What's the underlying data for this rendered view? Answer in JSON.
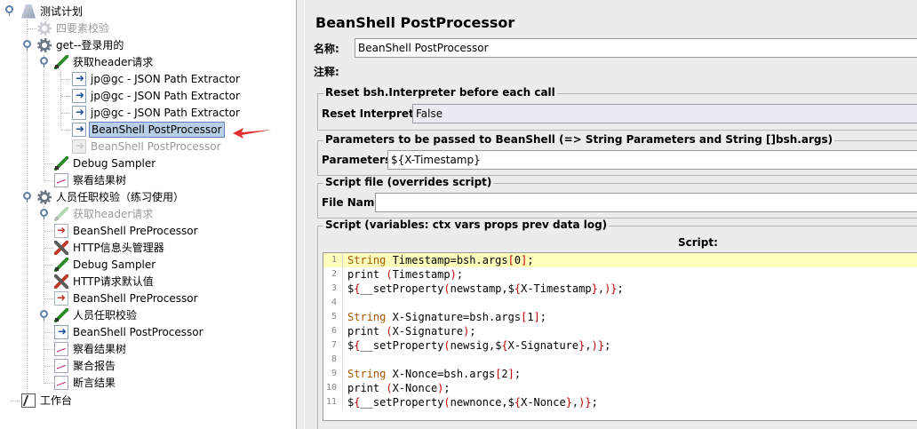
{
  "tree": {
    "root": "测试计划",
    "n_element_check": "四要素校验",
    "n_login": "get--登录用的",
    "n_get_header_1": "获取header请求",
    "n_json_1": "jp@gc - JSON Path Extractor",
    "n_json_2": "jp@gc - JSON Path Extractor",
    "n_json_3": "jp@gc - JSON Path Extractor",
    "n_beanshell_post_selected": "BeanShell PostProcessor",
    "n_beanshell_post_disabled": "BeanShell PostProcessor",
    "n_debug_1": "Debug Sampler",
    "n_result_tree_1": "察看结果树",
    "n_employment": "人员任职校验（练习使用）",
    "n_get_header_2": "获取header请求",
    "n_beanshell_pre_1": "BeanShell PreProcessor",
    "n_http_header_mgr": "HTTP信息头管理器",
    "n_debug_2": "Debug Sampler",
    "n_http_defaults": "HTTP请求默认值",
    "n_beanshell_pre_2": "BeanShell PreProcessor",
    "n_employment_check": "人员任职校验",
    "n_beanshell_post_2": "BeanShell PostProcessor",
    "n_result_tree_2": "察看结果树",
    "n_aggregate": "聚合报告",
    "n_assert_results": "断言结果",
    "workbench": "工作台"
  },
  "panel": {
    "title": "BeanShell PostProcessor",
    "name_label": "名称:",
    "name_value": "BeanShell PostProcessor",
    "comment_label": "注释:",
    "reset_group_title": "Reset bsh.Interpreter before each call",
    "reset_label": "Reset Interpreter:",
    "reset_value": "False",
    "params_group_title": "Parameters to be passed to BeanShell (=> String Parameters and String []bsh.args)",
    "params_label": "Parameters:",
    "params_value": "${X-Timestamp}",
    "file_group_title": "Script file (overrides script)",
    "file_label": "File Name:",
    "file_value": "",
    "script_group_title": "Script (variables: ctx vars props prev data log)",
    "script_label": "Script:"
  },
  "script_lines": [
    {
      "n": "1",
      "t": "String Timestamp=bsh.args[0];"
    },
    {
      "n": "2",
      "t": "print (Timestamp);"
    },
    {
      "n": "3",
      "t": "${__setProperty(newstamp,${X-Timestamp},)};"
    },
    {
      "n": "4",
      "t": ""
    },
    {
      "n": "5",
      "t": "String X-Signature=bsh.args[1];"
    },
    {
      "n": "6",
      "t": "print (X-Signature);"
    },
    {
      "n": "7",
      "t": "${__setProperty(newsig,${X-Signature},)};"
    },
    {
      "n": "8",
      "t": ""
    },
    {
      "n": "9",
      "t": "String X-Nonce=bsh.args[2];"
    },
    {
      "n": "10",
      "t": "print (X-Nonce);"
    },
    {
      "n": "11",
      "t": "${__setProperty(newnonce,${X-Nonce},)};"
    }
  ],
  "colors": {
    "selection": "#b8cfe5",
    "current_line": "#fdfdbc",
    "arrow": "#e03030",
    "keyword": "#a55a00"
  }
}
